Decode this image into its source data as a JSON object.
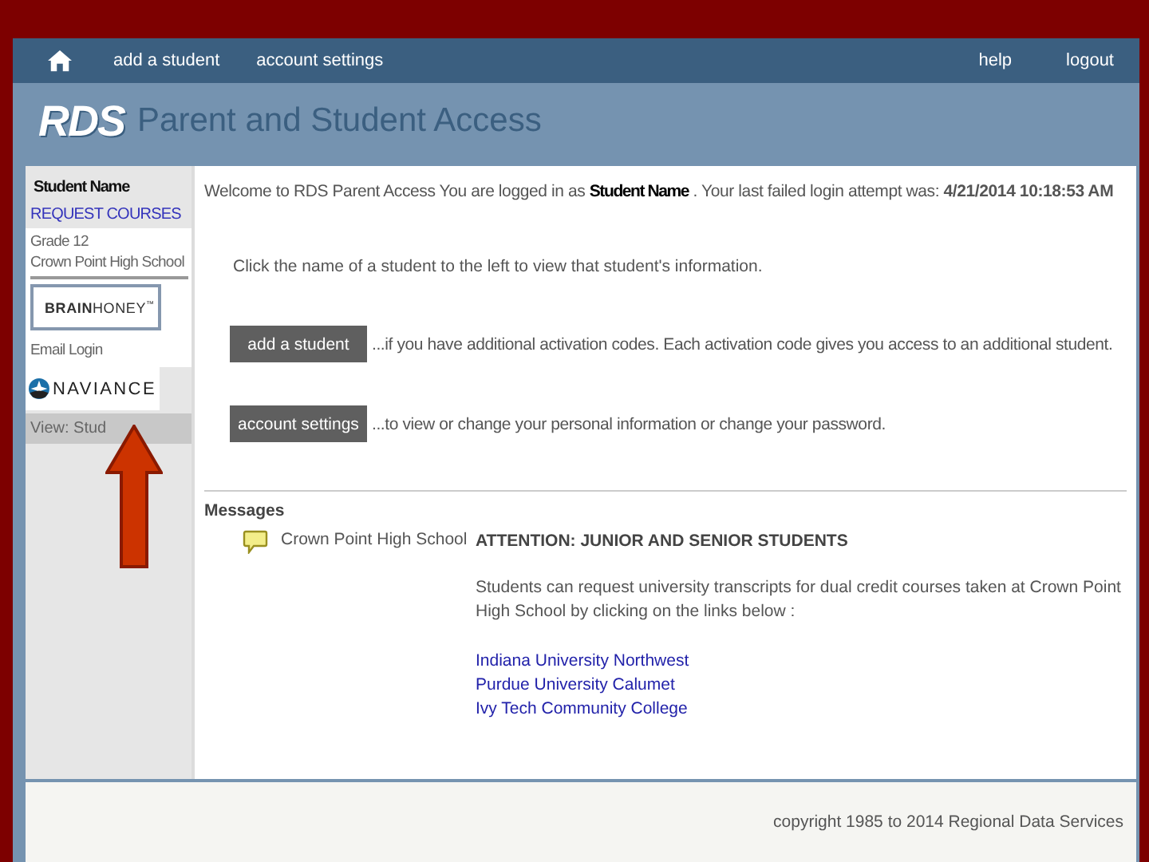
{
  "nav": {
    "links": [
      "add a student",
      "account settings"
    ],
    "right_links": [
      "help",
      "logout"
    ]
  },
  "header": {
    "logo": "RDS",
    "title": "Parent and Student Access"
  },
  "sidebar": {
    "student_name": "Student Name",
    "request_link": "REQUEST COURSES",
    "grade": "Grade 12",
    "school": "Crown Point High School",
    "brainhoney": {
      "bold": "BRAIN",
      "rest": "HONEY",
      "tm": "™"
    },
    "email_login": "Email Login",
    "naviance": "NAVIANCE",
    "view_item": "View: Stud"
  },
  "welcome": {
    "prefix": "Welcome to RDS Parent Access You are logged in as",
    "name": "Student Name",
    "middle": ". Your last failed login attempt was:",
    "timestamp": "4/21/2014 10:18:53 AM"
  },
  "instruction": "Click the name of a student to the left to view that student's information.",
  "actions": [
    {
      "button": "add a student",
      "text": "...if you have additional activation codes. Each activation code gives you access to an additional student."
    },
    {
      "button": "account settings",
      "text": "...to view or change your personal information or change your password."
    }
  ],
  "messages": {
    "heading": "Messages",
    "items": [
      {
        "from": "Crown Point High School",
        "title": "ATTENTION: JUNIOR AND SENIOR STUDENTS",
        "body": "Students can request university transcripts for dual credit courses taken at Crown Point High School by clicking on the links below :",
        "links": [
          "Indiana University Northwest",
          "Purdue University Calumet",
          "Ivy Tech Community College"
        ]
      }
    ]
  },
  "footer": "copyright 1985 to 2014 Regional Data Services"
}
